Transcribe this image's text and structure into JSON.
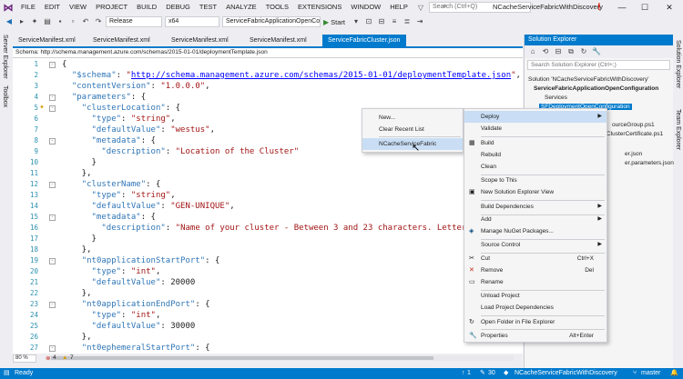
{
  "menubar": {
    "items": [
      "FILE",
      "EDIT",
      "VIEW",
      "PROJECT",
      "BUILD",
      "DEBUG",
      "TEST",
      "ANALYZE",
      "TOOLS",
      "EXTENSIONS",
      "WINDOW",
      "HELP"
    ],
    "quick_launch_placeholder": "Search (Ctrl+Q)",
    "window_title": "NCacheServiceFabricWithDiscovery"
  },
  "toolbar": {
    "config": "Release",
    "platform": "x64",
    "startup_project": "ServiceFabricApplicationOpenConf",
    "start_label": "Start"
  },
  "left_tabs": [
    "Server Explorer",
    "Toolbox"
  ],
  "doc_tabs": [
    {
      "label": "ServiceManifest.xml",
      "active": false
    },
    {
      "label": "ServiceManifest.xml",
      "active": false
    },
    {
      "label": "ServiceManifest.xml",
      "active": false
    },
    {
      "label": "ServiceManifest.xml",
      "active": false
    },
    {
      "label": "ServiceFabricCluster.json",
      "active": true
    }
  ],
  "schema_bar": "Schema: http://schema.management.azure.com/schemas/2015-01-01/deploymentTemplate.json",
  "editor": {
    "line_numbers": [
      "1",
      "2",
      "3",
      "4",
      "5",
      "6",
      "7",
      "8",
      "9",
      "10",
      "11",
      "12",
      "13",
      "14",
      "15",
      "16",
      "17",
      "18",
      "19",
      "20",
      "21",
      "22",
      "23",
      "24",
      "25",
      "26",
      "27",
      "28"
    ],
    "zoom": "80 %",
    "errors": "4",
    "warnings": "7"
  },
  "solution_explorer": {
    "title": "Solution Explorer",
    "search_placeholder": "Search Solution Explorer (Ctrl+;)",
    "solution_label": "Solution 'NCacheServiceFabricWithDiscovery'",
    "project_label": "ServiceFabricApplicationOpenConfiguration",
    "services_label": "Services",
    "selected_label": "SFDeploymentOpenConfiguration",
    "items": [
      "ourceGroup.ps1",
      "ClusterCertificate.ps1",
      "er.json",
      "er.parameters.json"
    ],
    "right_tabs": [
      "Solution Explorer",
      "Team Explorer"
    ]
  },
  "context_menu_main": {
    "items": [
      {
        "label": "Deploy",
        "shortcut": "",
        "submenu": true,
        "highlight": true
      },
      {
        "label": "Validate",
        "shortcut": ""
      },
      {
        "label": "Build",
        "shortcut": ""
      },
      {
        "label": "Rebuild",
        "shortcut": ""
      },
      {
        "label": "Clean",
        "shortcut": ""
      },
      {
        "label": "Scope to This",
        "shortcut": ""
      },
      {
        "label": "New Solution Explorer View",
        "shortcut": ""
      },
      {
        "label": "Build Dependencies",
        "shortcut": "",
        "submenu": true
      },
      {
        "label": "Add",
        "shortcut": "",
        "submenu": true
      },
      {
        "label": "Manage NuGet Packages...",
        "shortcut": ""
      },
      {
        "label": "Source Control",
        "shortcut": "",
        "submenu": true
      },
      {
        "label": "Cut",
        "shortcut": "Ctrl+X"
      },
      {
        "label": "Remove",
        "shortcut": "Del"
      },
      {
        "label": "Rename",
        "shortcut": ""
      },
      {
        "label": "Unload Project",
        "shortcut": ""
      },
      {
        "label": "Load Project Dependencies",
        "shortcut": ""
      },
      {
        "label": "Open Folder in File Explorer",
        "shortcut": ""
      },
      {
        "label": "Properties",
        "shortcut": "Alt+Enter"
      }
    ]
  },
  "context_menu_deploy": {
    "items": [
      {
        "label": "New...",
        "highlight": false
      },
      {
        "label": "Clear Recent List",
        "highlight": false
      },
      {
        "label": "NCacheServiceFabric",
        "highlight": true
      }
    ]
  },
  "statusbar": {
    "status": "Ready",
    "counter1": "1",
    "counter2": "30",
    "solution": "NCacheServiceFabricWithDiscovery",
    "branch": "master"
  },
  "colors": {
    "accent": "#007acc",
    "keyword": "#2e75b6",
    "string": "#a31515",
    "line_number": "#2b91af"
  }
}
